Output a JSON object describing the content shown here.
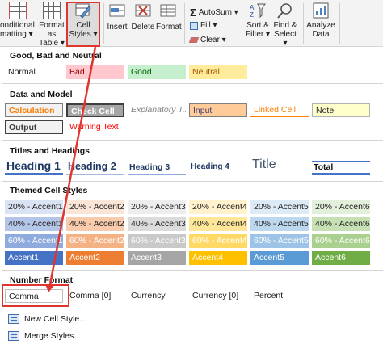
{
  "ribbon": {
    "conditional_formatting": [
      "onditional",
      "matting ▾"
    ],
    "format_as_table": [
      "Format as",
      "Table ▾"
    ],
    "cell_styles": [
      "Cell",
      "Styles ▾"
    ],
    "insert": "Insert",
    "delete": "Delete",
    "format": "Format",
    "autosum": "AutoSum ▾",
    "fill": "Fill ▾",
    "clear": "Clear ▾",
    "sort_filter": [
      "Sort &",
      "Filter ▾"
    ],
    "find_select": [
      "Find &",
      "Select ▾"
    ],
    "analyze_data": [
      "Analyze",
      "Data"
    ]
  },
  "sections": {
    "good_bad_neutral": "Good, Bad and Neutral",
    "data_model": "Data and Model",
    "titles_headings": "Titles and Headings",
    "themed": "Themed Cell Styles",
    "number_format": "Number Format"
  },
  "good_bad_neutral": [
    "Normal",
    "Bad",
    "Good",
    "Neutral"
  ],
  "data_model_row1": [
    "Calculation",
    "Check Cell",
    "Explanatory T...",
    "Input",
    "Linked Cell",
    "Note"
  ],
  "data_model_row2": [
    "Output",
    "Warning Text"
  ],
  "titles": [
    "Heading 1",
    "Heading 2",
    "Heading 3",
    "Heading 4",
    "Title",
    "Total"
  ],
  "themed": {
    "row20": [
      "20% - Accent1",
      "20% - Accent2",
      "20% - Accent3",
      "20% - Accent4",
      "20% - Accent5",
      "20% - Accent6"
    ],
    "row40": [
      "40% - Accent1",
      "40% - Accent2",
      "40% - Accent3",
      "40% - Accent4",
      "40% - Accent5",
      "40% - Accent6"
    ],
    "row60": [
      "60% - Accent1",
      "60% - Accent2",
      "60% - Accent3",
      "60% - Accent4",
      "60% - Accent5",
      "60% - Accent6"
    ],
    "accent": [
      "Accent1",
      "Accent2",
      "Accent3",
      "Accent4",
      "Accent5",
      "Accent6"
    ]
  },
  "number_format": [
    "Comma",
    "Comma [0]",
    "Currency",
    "Currency [0]",
    "Percent"
  ],
  "menu": {
    "new_cell_style": "New Cell Style...",
    "merge_styles": "Merge Styles..."
  },
  "colors": {
    "annotation_red": "#e0342f",
    "accent1": "#4472c4",
    "accent2": "#ed7d31",
    "accent3": "#a5a5a5",
    "accent4": "#ffc000",
    "accent5": "#5b9bd5",
    "accent6": "#70ad47"
  }
}
